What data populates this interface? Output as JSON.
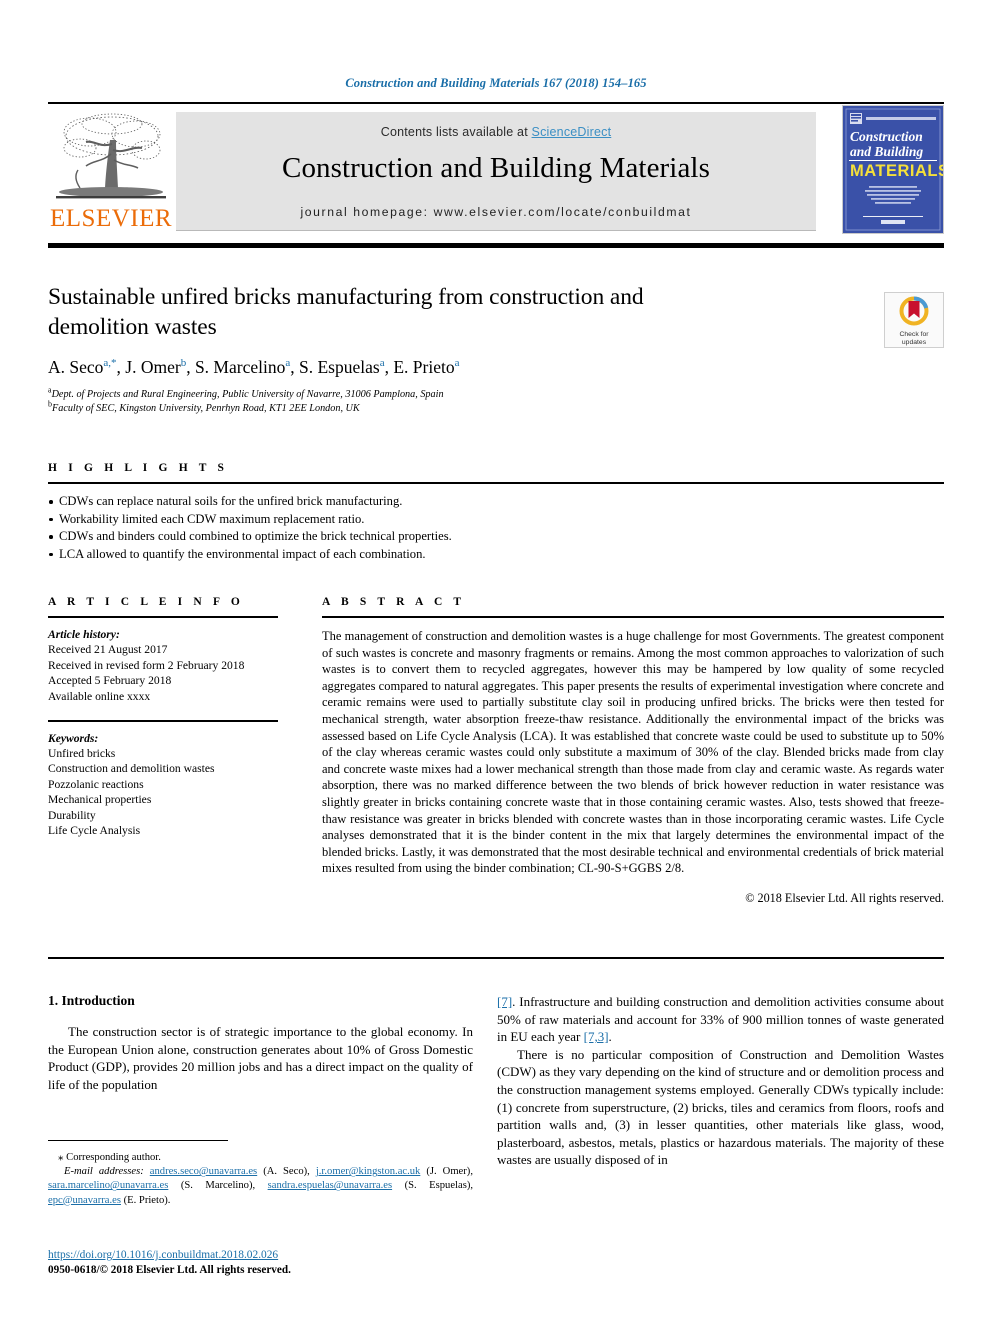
{
  "running_head": "Construction and Building Materials 167 (2018) 154–165",
  "masthead": {
    "contents_prefix": "Contents lists available at ",
    "sciencedirect": "ScienceDirect",
    "journal_name": "Construction and Building Materials",
    "homepage": "journal homepage: www.elsevier.com/locate/conbuildmat",
    "publisher": "ELSEVIER",
    "cover": {
      "line1": "Construction",
      "line2": "and Building",
      "line3": "MATERIALS",
      "blurb": "An International Journal Dedicated to the Investigation and Innovative Use of Materials in Construction and Repair",
      "footer": "Elsevier"
    }
  },
  "article": {
    "title": "Sustainable unfired bricks manufacturing from construction and demolition wastes",
    "authors": [
      {
        "name": "A. Seco",
        "marks": "a,*"
      },
      {
        "name": "J. Omer",
        "marks": "b"
      },
      {
        "name": "S. Marcelino",
        "marks": "a"
      },
      {
        "name": "S. Espuelas",
        "marks": "a"
      },
      {
        "name": "E. Prieto",
        "marks": "a"
      }
    ],
    "affiliations": [
      {
        "mark": "a",
        "text": "Dept. of Projects and Rural Engineering, Public University of Navarre, 31006 Pamplona, Spain"
      },
      {
        "mark": "b",
        "text": "Faculty of SEC, Kingston University, Penrhyn Road, KT1 2EE London, UK"
      }
    ],
    "crossmark": {
      "line1": "Check for",
      "line2": "updates"
    }
  },
  "highlights": {
    "heading": "H I G H L I G H T S",
    "items": [
      "CDWs can replace natural soils for the unfired brick manufacturing.",
      "Workability limited each CDW maximum replacement ratio.",
      "CDWs and binders could combined to optimize the brick technical properties.",
      "LCA allowed to quantify the environmental impact of each combination."
    ]
  },
  "article_info": {
    "heading": "A R T I C L E   I N F O",
    "history_label": "Article history:",
    "history": [
      "Received 21 August 2017",
      "Received in revised form 2 February 2018",
      "Accepted 5 February 2018",
      "Available online xxxx"
    ],
    "keywords_label": "Keywords:",
    "keywords": [
      "Unfired bricks",
      "Construction and demolition wastes",
      "Pozzolanic reactions",
      "Mechanical properties",
      "Durability",
      "Life Cycle Analysis"
    ]
  },
  "abstract": {
    "heading": "A B S T R A C T",
    "text": "The management of construction and demolition wastes is a huge challenge for most Governments. The greatest component of such wastes is concrete and masonry fragments or remains. Among the most common approaches to valorization of such wastes is to convert them to recycled aggregates, however this may be hampered by low quality of some recycled aggregates compared to natural aggregates. This paper presents the results of experimental investigation where concrete and ceramic remains were used to partially substitute clay soil in producing unfired bricks. The bricks were then tested for mechanical strength, water absorption freeze-thaw resistance. Additionally the environmental impact of the bricks was assessed based on Life Cycle Analysis (LCA). It was established that concrete waste could be used to substitute up to 50% of the clay whereas ceramic wastes could only substitute a maximum of 30% of the clay. Blended bricks made from clay and concrete waste mixes had a lower mechanical strength than those made from clay and ceramic waste. As regards water absorption, there was no marked difference between the two blends of brick however reduction in water resistance was slightly greater in bricks containing concrete waste that in those containing ceramic wastes. Also, tests showed that freeze-thaw resistance was greater in bricks blended with concrete wastes than in those incorporating ceramic wastes. Life Cycle analyses demonstrated that it is the binder content in the mix that largely determines the environmental impact of the blended bricks. Lastly, it was demonstrated that the most desirable technical and environmental credentials of brick material mixes resulted from using the binder combination; CL-90-S+GGBS 2/8.",
    "copyright": "© 2018 Elsevier Ltd. All rights reserved."
  },
  "introduction": {
    "heading": "1. Introduction",
    "left_para_1": "The construction sector is of strategic importance to the global economy. In the European Union alone, construction generates about 10% of Gross Domestic Product (GDP), provides 20 million jobs and has a direct impact on the quality of life of the population",
    "right_ref_1": "[7]",
    "right_para_1_rest": ". Infrastructure and building construction and demolition activities consume about 50% of raw materials and account for 33% of 900 million tonnes of waste generated in EU each year ",
    "right_ref_2": "[7,3]",
    "right_para_1_end": ".",
    "right_para_2": "There is no particular composition of Construction and Demolition Wastes (CDW) as they vary depending on the kind of structure and or demolition process and the construction management systems employed. Generally CDWs typically include: (1) concrete from superstructure, (2) bricks, tiles and ceramics from floors, roofs and partition walls and, (3) in lesser quantities, other materials like glass, wood, plasterboard, asbestos, metals, plastics or hazardous materials. The majority of these wastes are usually disposed of in"
  },
  "footnote": {
    "corresponding": "Corresponding author.",
    "email_label": "E-mail addresses:",
    "emails": [
      {
        "address": "andres.seco@unavarra.es",
        "who": "(A. Seco)"
      },
      {
        "address": "j.r.omer@kingston.ac.uk",
        "who": "(J. Omer)"
      },
      {
        "address": "sara.marcelino@unavarra.es",
        "who": "(S. Marcelino)"
      },
      {
        "address": "sandra.espuelas@unavarra.es",
        "who": "(S. Espuelas)"
      },
      {
        "address": "epc@unavarra.es",
        "who": "(E. Prieto)"
      }
    ],
    "doi": "https://doi.org/10.1016/j.conbuildmat.2018.02.026",
    "issn": "0950-0618/© 2018 Elsevier Ltd. All rights reserved."
  },
  "colors": {
    "link": "#1a6ea8",
    "sciencedirect": "#3b8fc4",
    "elsevier_orange": "#eb6c09",
    "cover_blue": "#3a51a8",
    "cover_yellow": "#f5e03a",
    "crossmark_yellow": "#f0b323",
    "crossmark_red": "#c8102e"
  }
}
